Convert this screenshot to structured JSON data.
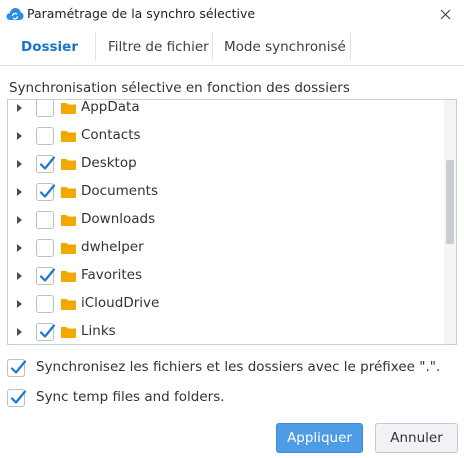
{
  "window": {
    "title": "Paramétrage de la synchro sélective",
    "app_icon": "cloud-sync-icon",
    "close_icon": "close-icon"
  },
  "tabs": [
    {
      "label": "Dossier",
      "active": true
    },
    {
      "label": "Filtre de fichier",
      "active": false
    },
    {
      "label": "Mode synchronisé",
      "active": false
    }
  ],
  "section_label": "Synchronisation sélective en fonction des dossiers",
  "tree": {
    "items": [
      {
        "label": "AppData",
        "checked": false
      },
      {
        "label": "Contacts",
        "checked": false
      },
      {
        "label": "Desktop",
        "checked": true
      },
      {
        "label": "Documents",
        "checked": true
      },
      {
        "label": "Downloads",
        "checked": false
      },
      {
        "label": "dwhelper",
        "checked": false
      },
      {
        "label": "Favorites",
        "checked": true
      },
      {
        "label": "iCloudDrive",
        "checked": false
      },
      {
        "label": "Links",
        "checked": true
      }
    ]
  },
  "options": {
    "prefix_label": "Synchronisez les fichiers et les dossiers avec le préfixee \".\".",
    "prefix_checked": true,
    "temp_label": "Sync temp files and folders.",
    "temp_checked": true
  },
  "buttons": {
    "apply": "Appliquer",
    "cancel": "Annuler"
  },
  "colors": {
    "accent": "#1a73c8",
    "check": "#1e78d0",
    "folder": "#f2a900",
    "primary_button": "#4f9ce6"
  }
}
